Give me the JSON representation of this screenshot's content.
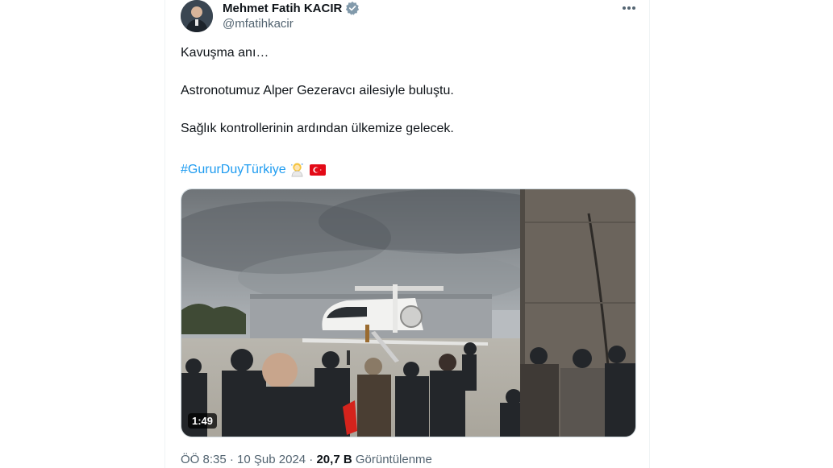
{
  "author": {
    "name": "Mehmet Fatih KACIR",
    "handle": "@mfatihkacir"
  },
  "tweet": {
    "line1": "Kavuşma anı…",
    "line2": "Astronotumuz Alper Gezeravcı ailesiyle buluştu.",
    "line3": "Sağlık kontrollerinin ardından ülkemize gelecek.",
    "hashtag": "#GururDuyTürkiye"
  },
  "media": {
    "duration": "1:49"
  },
  "meta": {
    "time": "ÖÖ 8:35",
    "separator": " · ",
    "date": "10 Şub 2024",
    "views_count": "20,7 B",
    "views_label": "Görüntülenme"
  },
  "colors": {
    "link": "#1d9bf0",
    "verified": "#829aab",
    "secondary_text": "#536471"
  }
}
